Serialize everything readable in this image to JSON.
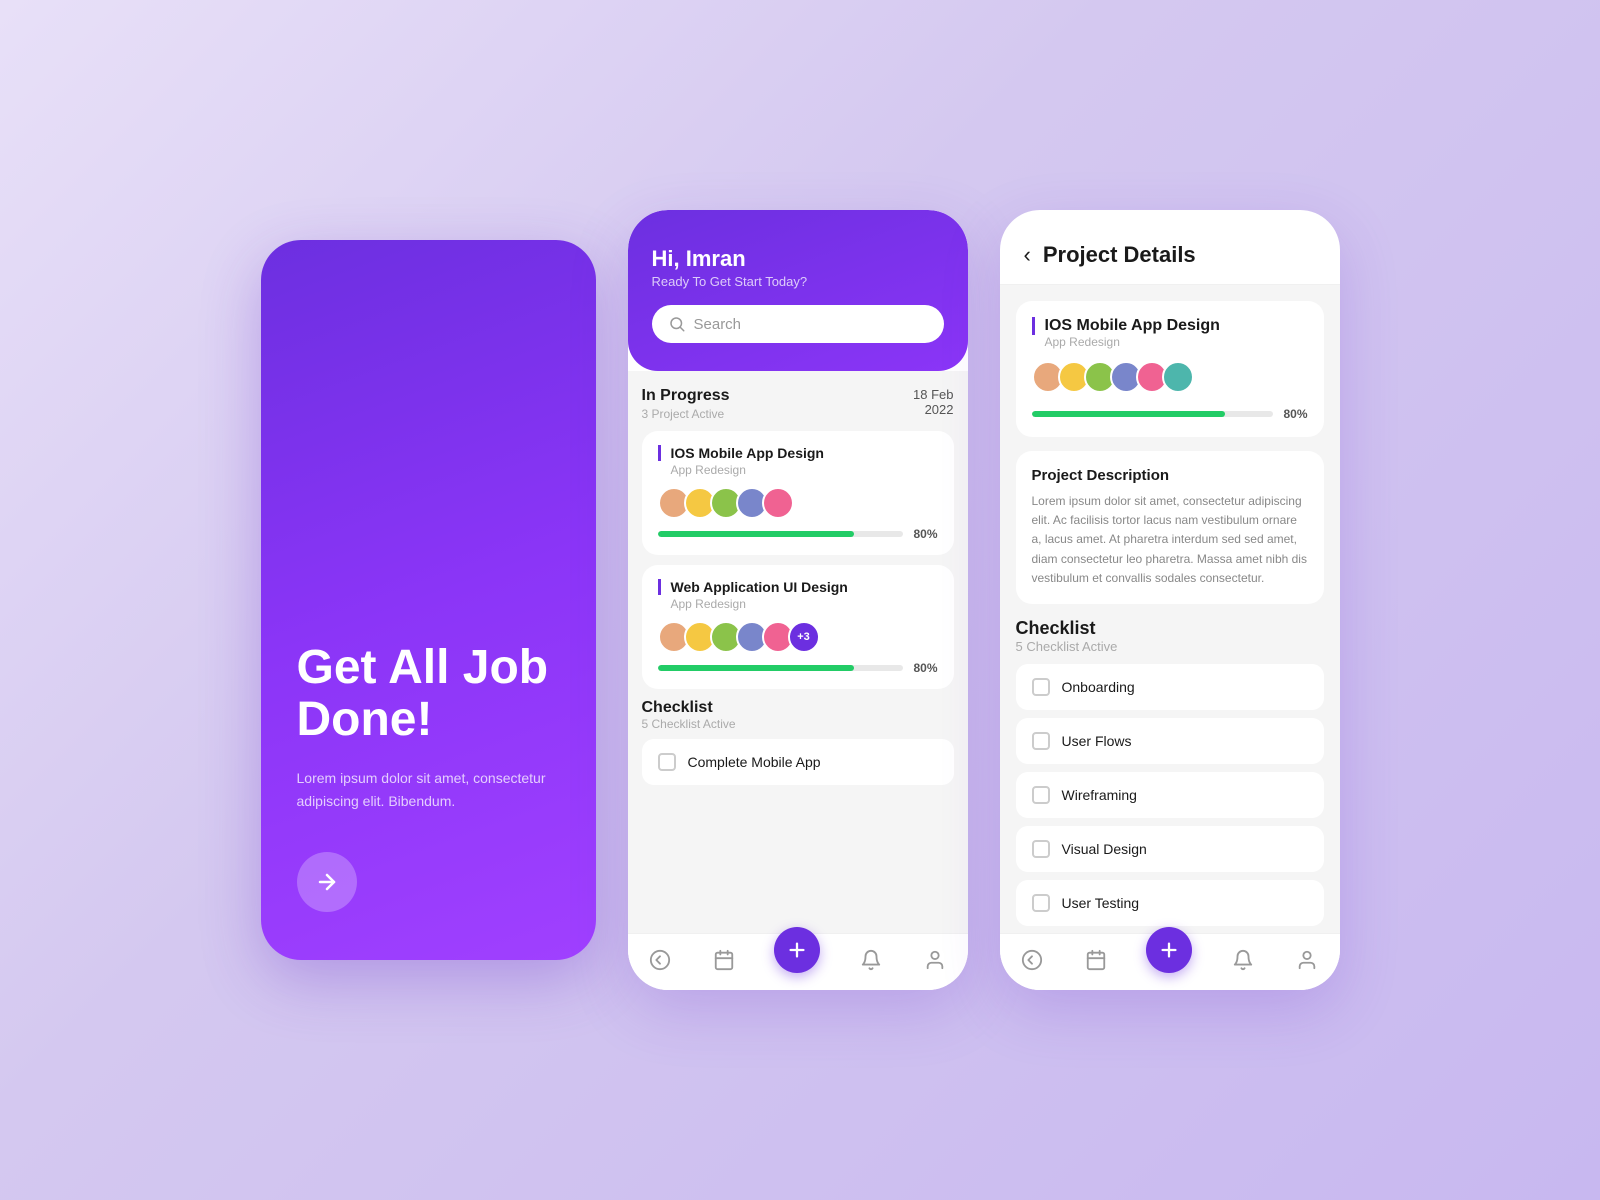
{
  "screen1": {
    "title": "Get All Job Done!",
    "description": "Lorem ipsum dolor sit amet, consectetur adipiscing elit. Bibendum.",
    "arrow_label": "next arrow"
  },
  "screen2": {
    "header": {
      "greeting": "Hi, Imran",
      "subtitle": "Ready To Get Start Today?",
      "search_placeholder": "Search"
    },
    "in_progress": {
      "title": "In Progress",
      "subtitle": "3 Project Active",
      "date": "18 Feb",
      "year": "2022"
    },
    "projects": [
      {
        "title": "IOS Mobile App Design",
        "subtitle": "App Redesign",
        "progress": 80,
        "progress_label": "80%"
      },
      {
        "title": "Web Application UI Design",
        "subtitle": "App Redesign",
        "progress": 80,
        "progress_label": "80%",
        "extra_count": "+3"
      }
    ],
    "checklist": {
      "title": "Checklist",
      "subtitle": "5 Checklist Active",
      "items": [
        {
          "label": "Complete Mobile App"
        }
      ]
    }
  },
  "screen3": {
    "title": "Project Details",
    "back_label": "‹",
    "project": {
      "title": "IOS Mobile App Design",
      "subtitle": "App Redesign",
      "progress": 80,
      "progress_label": "80%"
    },
    "description": {
      "title": "Project Description",
      "text": "Lorem ipsum dolor sit amet, consectetur adipiscing elit. Ac facilisis tortor lacus nam vestibulum ornare a, lacus amet. At pharetra interdum sed sed amet, diam consectetur leo pharetra. Massa amet nibh dis vestibulum et convallis sodales consectetur."
    },
    "checklist": {
      "title": "Checklist",
      "subtitle": "5 Checklist Active",
      "items": [
        {
          "label": "Onboarding"
        },
        {
          "label": "User Flows"
        },
        {
          "label": "Wireframing"
        },
        {
          "label": "Visual Design"
        },
        {
          "label": "User Testing"
        }
      ]
    }
  }
}
